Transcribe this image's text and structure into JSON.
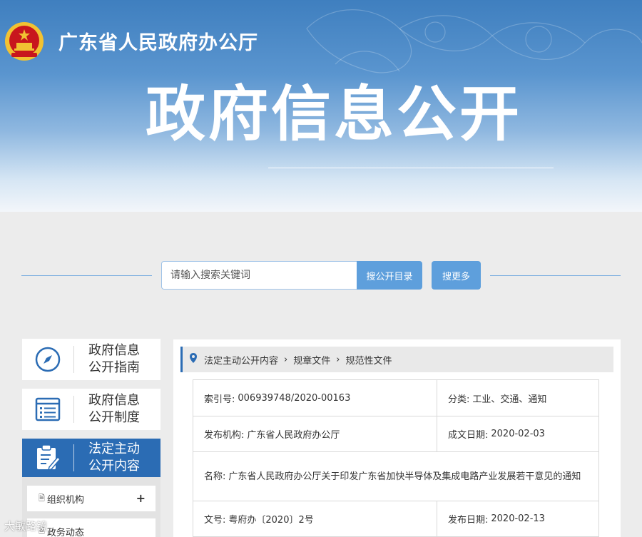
{
  "header": {
    "org_name": "广东省人民政府办公厅",
    "main_title": "政府信息公开"
  },
  "search": {
    "placeholder": "请输入搜索关键词",
    "catalog_button": "搜公开目录",
    "more_button": "搜更多"
  },
  "sidebar": {
    "items": [
      {
        "label_line1": "政府信息",
        "label_line2": "公开指南",
        "icon": "compass-icon"
      },
      {
        "label_line1": "政府信息",
        "label_line2": "公开制度",
        "icon": "document-list-icon"
      },
      {
        "label_line1": "法定主动",
        "label_line2": "公开内容",
        "icon": "clipboard-edit-icon"
      }
    ],
    "sub_items": [
      {
        "label": "组织机构",
        "icon": "doc-icon",
        "expand": "+"
      },
      {
        "label": "政务动态",
        "icon": "doc-icon"
      }
    ]
  },
  "breadcrumb": {
    "items": [
      "法定主动公开内容",
      "规章文件",
      "规范性文件"
    ],
    "separator": "›"
  },
  "info": {
    "index_label": "索引号:",
    "index_value": "006939748/2020-00163",
    "category_label": "分类:",
    "category_value": "工业、交通、通知",
    "issuer_label": "发布机构:",
    "issuer_value": "广东省人民政府办公厅",
    "created_label": "成文日期:",
    "created_value": "2020-02-03",
    "name_label": "名称:",
    "name_value": "广东省人民政府办公厅关于印发广东省加快半导体及集成电路产业发展若干意见的通知",
    "docno_label": "文号:",
    "docno_value": "粤府办〔2020〕2号",
    "published_label": "发布日期:",
    "published_value": "2020-02-13"
  },
  "watermark": "大敏路镜",
  "colors": {
    "primary": "#2b6cb4",
    "button": "#5e9fdc",
    "emblem_red": "#c8161d",
    "emblem_gold": "#f1c232"
  }
}
